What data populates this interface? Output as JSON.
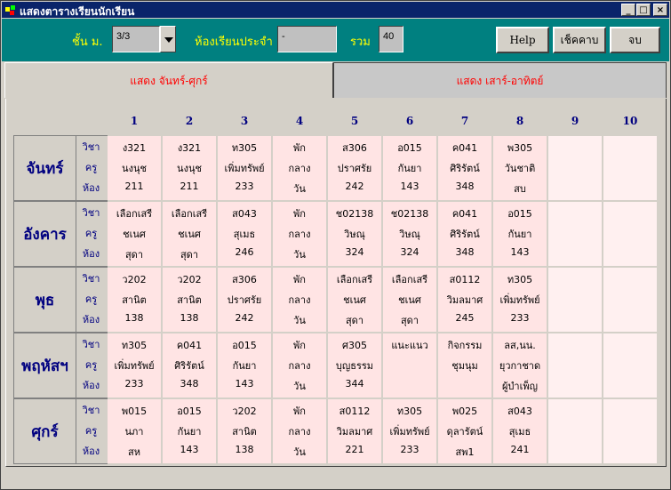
{
  "window": {
    "title": "แสดงตารางเรียนนักเรียน"
  },
  "titlebar_buttons": {
    "minimize": "_",
    "maximize": "□",
    "close": "×"
  },
  "toolbar": {
    "grade_label": "ชั้น ม.",
    "grade_value": "3/3",
    "room_label": "ห้องเรียนประจำ",
    "room_value": "-",
    "total_label": "รวม",
    "total_value": "40",
    "help_button": "Help",
    "check_button": "เช็คคาบ",
    "exit_button": "จบ"
  },
  "tabs": [
    {
      "label": "แสดง จันทร์-ศุกร์",
      "active": true
    },
    {
      "label": "แสดง เสาร์-อาทิตย์",
      "active": false
    }
  ],
  "periods": [
    "1",
    "2",
    "3",
    "4",
    "5",
    "6",
    "7",
    "8",
    "9",
    "10"
  ],
  "row_labels": {
    "subject": "วิชา",
    "teacher": "ครู",
    "room": "ห้อง"
  },
  "days": [
    {
      "name": "จันทร์",
      "cells": [
        [
          "ง321",
          "นงนุช",
          "211"
        ],
        [
          "ง321",
          "นงนุช",
          "211"
        ],
        [
          "ท305",
          "เพิ่มทรัพย์",
          "233"
        ],
        [
          "พัก",
          "กลาง",
          "วัน"
        ],
        [
          "ส306",
          "ปราศรัย",
          "242"
        ],
        [
          "อ015",
          "กันยา",
          "143"
        ],
        [
          "ค041",
          "ศิริรัตน์",
          "348"
        ],
        [
          "พ305",
          "วันชาติ",
          "สบ"
        ],
        [
          "",
          "",
          ""
        ],
        [
          "",
          "",
          ""
        ]
      ]
    },
    {
      "name": "อังคาร",
      "cells": [
        [
          "เลือกเสรี",
          "ชเนศ",
          "สุดา"
        ],
        [
          "เลือกเสรี",
          "ชเนศ",
          "สุดา"
        ],
        [
          "ส043",
          "สุเมธ",
          "246"
        ],
        [
          "พัก",
          "กลาง",
          "วัน"
        ],
        [
          "ช02138",
          "วิษณุ",
          "324"
        ],
        [
          "ช02138",
          "วิษณุ",
          "324"
        ],
        [
          "ค041",
          "ศิริรัตน์",
          "348"
        ],
        [
          "อ015",
          "กันยา",
          "143"
        ],
        [
          "",
          "",
          ""
        ],
        [
          "",
          "",
          ""
        ]
      ]
    },
    {
      "name": "พุธ",
      "cells": [
        [
          "ว202",
          "สานิต",
          "138"
        ],
        [
          "ว202",
          "สานิต",
          "138"
        ],
        [
          "ส306",
          "ปราศรัย",
          "242"
        ],
        [
          "พัก",
          "กลาง",
          "วัน"
        ],
        [
          "เลือกเสรี",
          "ชเนศ",
          "สุดา"
        ],
        [
          "เลือกเสรี",
          "ชเนศ",
          "สุดา"
        ],
        [
          "ส0112",
          "วิมลมาศ",
          "245"
        ],
        [
          "ท305",
          "เพิ่มทรัพย์",
          "233"
        ],
        [
          "",
          "",
          ""
        ],
        [
          "",
          "",
          ""
        ]
      ]
    },
    {
      "name": "พฤหัสฯ",
      "cells": [
        [
          "ท305",
          "เพิ่มทรัพย์",
          "233"
        ],
        [
          "ค041",
          "ศิริรัตน์",
          "348"
        ],
        [
          "อ015",
          "กันยา",
          "143"
        ],
        [
          "พัก",
          "กลาง",
          "วัน"
        ],
        [
          "ศ305",
          "บุญธรรม",
          "344"
        ],
        [
          "แนะแนว",
          "",
          ""
        ],
        [
          "กิจกรรม",
          "ชุมนุม",
          ""
        ],
        [
          "ลส,นน.",
          "ยุวกาชาด",
          "ผู้บำเพ็ญ"
        ],
        [
          "",
          "",
          ""
        ],
        [
          "",
          "",
          ""
        ]
      ]
    },
    {
      "name": "ศุกร์",
      "cells": [
        [
          "พ015",
          "นภา",
          "สห"
        ],
        [
          "อ015",
          "กันยา",
          "143"
        ],
        [
          "ว202",
          "สานิต",
          "138"
        ],
        [
          "พัก",
          "กลาง",
          "วัน"
        ],
        [
          "ส0112",
          "วิมลมาศ",
          "221"
        ],
        [
          "ท305",
          "เพิ่มทรัพย์",
          "233"
        ],
        [
          "พ025",
          "ดุลารัตน์",
          "สพ1"
        ],
        [
          "ส043",
          "สุเมธ",
          "241"
        ],
        [
          "",
          "",
          ""
        ],
        [
          "",
          "",
          ""
        ]
      ]
    }
  ],
  "colors": {
    "cell_bg": "#ffe4e4",
    "cell_bg_empty": "#fff0f0",
    "toolbar_bg": "#008080",
    "title_bg": "#0a246a"
  }
}
